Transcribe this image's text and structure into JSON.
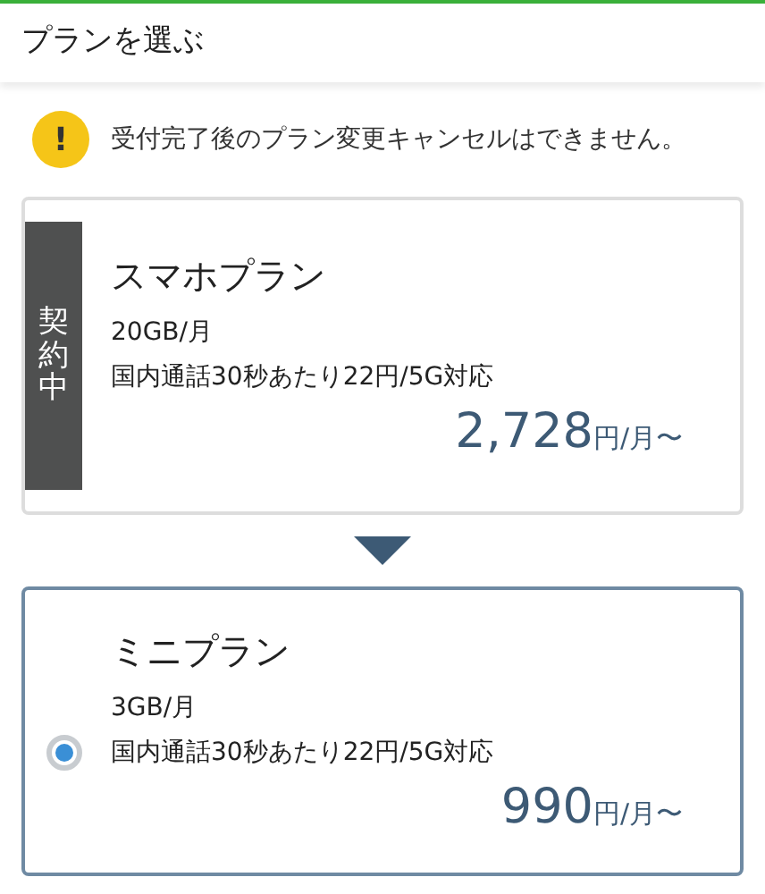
{
  "header": {
    "title": "プランを選ぶ"
  },
  "notice": {
    "icon_text": "!",
    "text": "受付完了後のプラン変更キャンセルはできません。"
  },
  "plans": [
    {
      "kind": "current",
      "badge": "契約中",
      "name": "スマホプラン",
      "data": "20GB/月",
      "detail": "国内通話30秒あたり22円/5G対応",
      "price": "2,728",
      "unit": "円/月〜"
    },
    {
      "kind": "option",
      "selected": true,
      "name": "ミニプラン",
      "data": "3GB/月",
      "detail": "国内通話30秒あたり22円/5G対応",
      "price": "990",
      "unit": "円/月〜"
    }
  ]
}
